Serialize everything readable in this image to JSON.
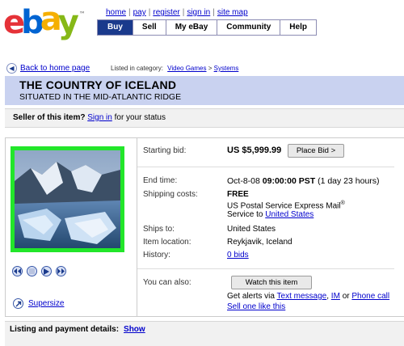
{
  "header": {
    "logo_text": "ebay",
    "logo_tm": "™",
    "top_links": [
      "home",
      "pay",
      "register",
      "sign in",
      "site map"
    ],
    "nav_tabs": [
      "Buy",
      "Sell",
      "My eBay",
      "Community",
      "Help"
    ],
    "active_tab": "Buy"
  },
  "breadcrumb": {
    "back_label": "Back to home page",
    "category_label": "Listed in category:",
    "category_1": "Video Games",
    "category_sep": ">",
    "category_2": "Systems"
  },
  "title": {
    "main": "THE COUNTRY OF ICELAND",
    "subtitle": "SITUATED IN THE MID-ATLANTIC RIDGE"
  },
  "seller": {
    "question": "Seller of this item?",
    "sign_in": "Sign in",
    "suffix": "for your status"
  },
  "listing": {
    "starting_bid_label": "Starting bid:",
    "starting_bid_value": "US $5,999.99",
    "place_bid_button": "Place Bid >",
    "end_time_label": "End time:",
    "end_date": "Oct-8-08",
    "end_time": "09:00:00 PST",
    "end_remaining": "(1 day 23 hours)",
    "shipping_label": "Shipping costs:",
    "shipping_value": "FREE",
    "shipping_service": "US Postal Service Express Mail",
    "shipping_service_mark": "®",
    "service_to_prefix": "Service to",
    "service_to_link": "United States",
    "ships_to_label": "Ships to:",
    "ships_to_value": "United States",
    "location_label": "Item location:",
    "location_value": "Reykjavik, Iceland",
    "history_label": "History:",
    "history_value": "0 bids",
    "also_label": "You can also:",
    "watch_button": "Watch this item",
    "alerts_prefix": "Get alerts via",
    "alerts_text_message": "Text message",
    "alerts_im": "IM",
    "alerts_or": "or",
    "alerts_phone": "Phone call",
    "sell_one": "Sell one like this",
    "supersize": "Supersize"
  },
  "footer": {
    "label": "Listing and payment details:",
    "show": "Show"
  },
  "colors": {
    "nav_active": "#1a3a8c",
    "banner": "#c9d2f0",
    "photo_border": "#22e62a",
    "link": "#0000cc"
  }
}
